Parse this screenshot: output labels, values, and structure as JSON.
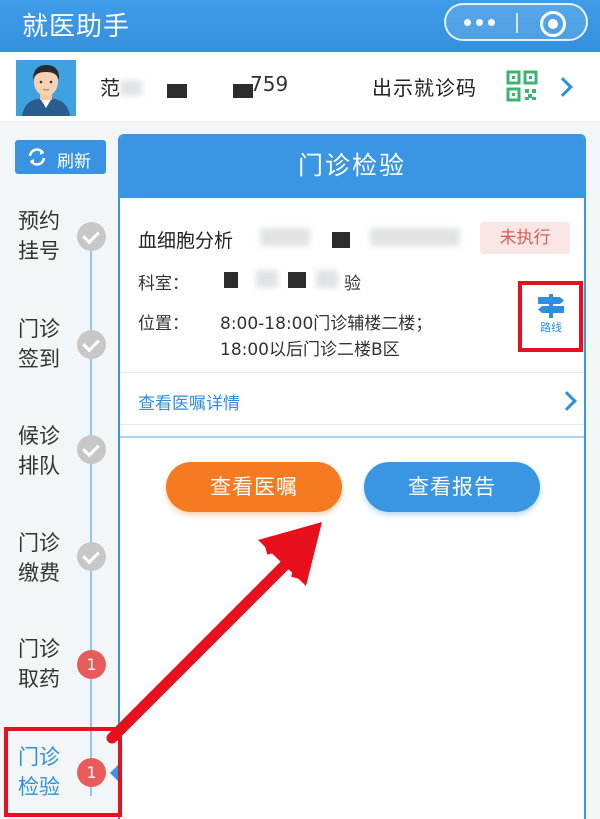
{
  "header": {
    "title": "就医助手",
    "more_icon": "more-dots-icon",
    "close_icon": "mini-program-close-icon"
  },
  "profile": {
    "avatar_icon": "male-avatar-icon",
    "name_visible_start": "范",
    "name_visible_end": "759",
    "show_code_label": "出示就诊码",
    "qr_icon": "qr-code-icon"
  },
  "sidebar": {
    "refresh_label": "刷新",
    "steps": [
      {
        "label": "预约挂号",
        "state": "done"
      },
      {
        "label": "门诊签到",
        "state": "done"
      },
      {
        "label": "候诊排队",
        "state": "done"
      },
      {
        "label": "门诊缴费",
        "state": "done"
      },
      {
        "label": "门诊取药",
        "state": "pending",
        "badge": "1"
      },
      {
        "label": "门诊检验",
        "state": "active",
        "badge": "1"
      }
    ]
  },
  "card": {
    "title": "门诊检验",
    "test_name": "血细胞分析",
    "status": "未执行",
    "dept_label": "科室：",
    "dept_visible_end": "验",
    "location_label": "位置：",
    "location_line1": "8:00-18:00门诊辅楼二楼；",
    "location_line2": "18:00以后门诊二楼B区",
    "route_label": "路线",
    "detail_link": "查看医嘱详情",
    "btn_view_orders": "查看医嘱",
    "btn_view_report": "查看报告"
  },
  "colors": {
    "primary": "#3a96e2",
    "orange": "#f57a21",
    "status_red": "#e05a5a",
    "annotation_red": "#e8101c"
  }
}
